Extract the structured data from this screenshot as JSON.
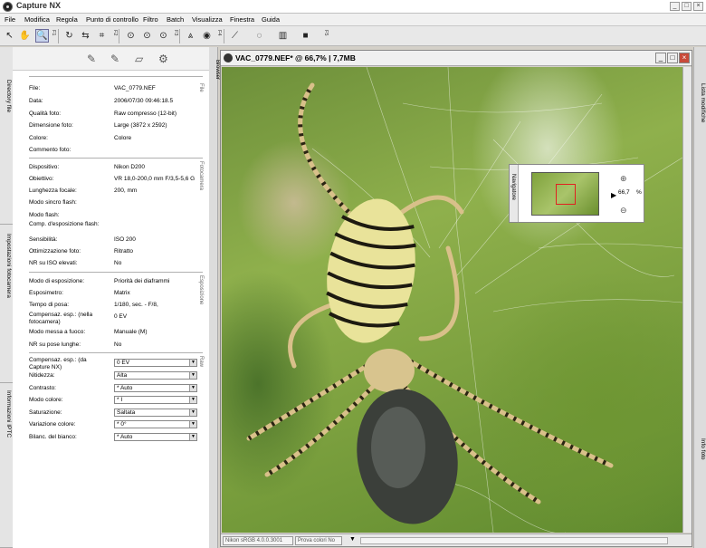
{
  "app": {
    "title": "Capture NX"
  },
  "menu": [
    "File",
    "Modifica",
    "Regola",
    "Punto di controllo",
    "Filtro",
    "Batch",
    "Visualizza",
    "Finestra",
    "Guida"
  ],
  "toolbar": {
    "group1": "F1",
    "group2": "F2",
    "group3": "F3",
    "group4": "F4",
    "group5": "F5"
  },
  "left_tabs": {
    "directory": "Directory file",
    "camera": "Impostazioni fotocamera",
    "iptc": "Informazioni IPTC"
  },
  "browser_tab": "Browser",
  "right_tabs": {
    "edit_list": "Lista modifiche",
    "info": "Info foto"
  },
  "info": {
    "file_section": "File",
    "file_rows": [
      {
        "label": "File:",
        "value": "VAC_0779.NEF"
      },
      {
        "label": "Data:",
        "value": "2006/07/30 09:46:18.5"
      },
      {
        "label": "Qualità foto:",
        "value": "Raw compresso (12-bit)"
      },
      {
        "label": "Dimensione foto:",
        "value": "Large (3872 x 2592)"
      },
      {
        "label": "Colore:",
        "value": "Colore"
      },
      {
        "label": "Commento foto:",
        "value": ""
      }
    ],
    "camera_section": "Fotocamera",
    "camera_rows": [
      {
        "label": "Dispositivo:",
        "value": "Nikon D200"
      },
      {
        "label": "Obiettivo:",
        "value": "VR 18,0-200,0 mm F/3,5-5,6 G"
      },
      {
        "label": "Lunghezza focale:",
        "value": "200, mm"
      },
      {
        "label": "Modo sincro flash:",
        "value": ""
      },
      {
        "label": "Modo flash:",
        "value": ""
      },
      {
        "label": "Comp. d'esposizione flash:",
        "value": ""
      },
      {
        "label": "Sensibilità:",
        "value": "ISO 200"
      },
      {
        "label": "Ottimizzazione foto:",
        "value": "Ritratto"
      },
      {
        "label": "NR su ISO elevati:",
        "value": "No"
      }
    ],
    "exposure_section": "Esposizione",
    "exposure_rows": [
      {
        "label": "Modo di esposizione:",
        "value": "Priorità dei diaframmi"
      },
      {
        "label": "Esposimetro:",
        "value": "Matrix"
      },
      {
        "label": "Tempo di posa:",
        "value": "1/180, sec. - F/8,"
      },
      {
        "label": "Compensaz. esp.: (nella fotocamera)",
        "value": "0 EV"
      },
      {
        "label": "Modo messa a fuoco:",
        "value": "Manuale (M)"
      },
      {
        "label": "NR su pose lunghe:",
        "value": "No"
      }
    ],
    "raw_section": "Raw",
    "raw_rows": [
      {
        "label": "Compensaz. esp.: (da Capture NX)",
        "value": "0 EV"
      },
      {
        "label": "Nitidezza:",
        "value": "Alta"
      },
      {
        "label": "Contrasto:",
        "value": "* Auto"
      },
      {
        "label": "Modo colore:",
        "value": "* I"
      },
      {
        "label": "Saturazione:",
        "value": "Saltata"
      },
      {
        "label": "Variazione colore:",
        "value": "* 0°"
      },
      {
        "label": "Bilanc. del bianco:",
        "value": "* Auto"
      }
    ]
  },
  "image_window": {
    "title": "VAC_0779.NEF* @ 66,7% | 7,7MB",
    "status_profile": "Nikon sRGB 4.0.0.3001",
    "status_proof": "Prova colori No"
  },
  "navigator": {
    "label": "Navigatore",
    "zoom": "66,7",
    "unit": "%"
  }
}
